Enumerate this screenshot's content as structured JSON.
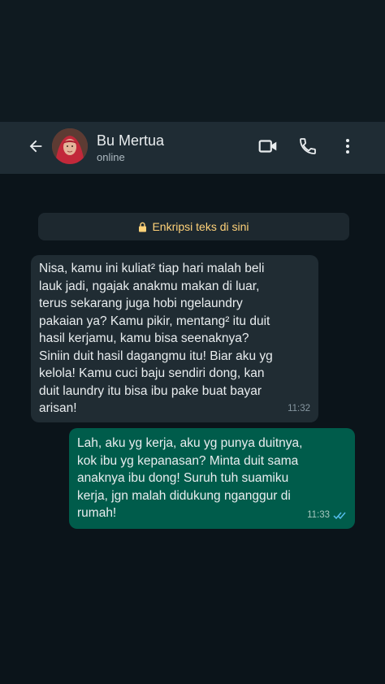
{
  "header": {
    "contact_name": "Bu Mertua",
    "contact_status": "online",
    "back_icon": "arrow-left-icon",
    "video_icon": "video-camera-icon",
    "call_icon": "phone-icon",
    "menu_icon": "more-vertical-icon"
  },
  "chat": {
    "encryption_notice": "Enkripsi teks di sini",
    "messages": [
      {
        "direction": "incoming",
        "text": "Nisa, kamu ini kuliat² tiap hari malah beli\nlauk jadi, ngajak anakmu makan di luar,\nterus sekarang juga hobi ngelaundry\npakaian ya? Kamu pikir, mentang² itu duit\nhasil kerjamu, kamu bisa seenaknya?\nSiniin duit hasil dagangmu itu! Biar aku yg\nkelola! Kamu cuci baju sendiri dong, kan\nduit laundry itu bisa ibu pake buat bayar\narisan!",
        "time": "11:32"
      },
      {
        "direction": "outgoing",
        "text": "Lah, aku yg kerja, aku yg punya duitnya,\nkok ibu yg kepanasan? Minta duit sama\nanaknya ibu dong! Suruh tuh suamiku\nkerja, jgn malah didukung nganggur di\nrumah!",
        "time": "11:33",
        "status": "read"
      }
    ]
  },
  "colors": {
    "header_bg": "#1f2c34",
    "chat_bg": "#0b141a",
    "incoming_bubble": "#202c33",
    "outgoing_bubble": "#005c4b",
    "read_tick": "#53bdeb",
    "encryption_text": "#ffd279"
  }
}
